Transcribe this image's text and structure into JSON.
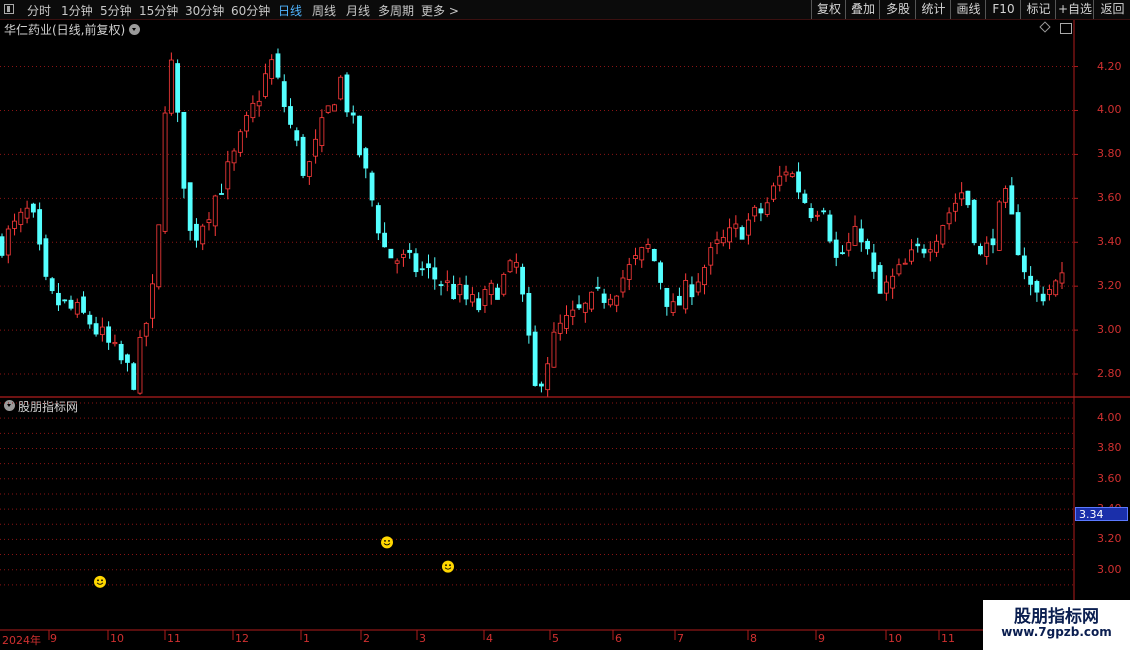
{
  "toolbar": {
    "periods": [
      "分时",
      "1分钟",
      "5分钟",
      "15分钟",
      "30分钟",
      "60分钟",
      "日线",
      "周线",
      "月线",
      "多周期",
      "更多 >"
    ],
    "active_period": "日线",
    "right_buttons": [
      "复权",
      "叠加",
      "多股",
      "统计",
      "画线",
      "F10",
      "标记",
      "+自选",
      "返回"
    ]
  },
  "main_panel": {
    "stock_title": "华仁药业(日线,前复权)",
    "price_ticks": [
      "4.20",
      "4.00",
      "3.80",
      "3.60",
      "3.40",
      "3.20",
      "3.00",
      "2.80"
    ]
  },
  "indicator_panel": {
    "title": "股朋指标网",
    "price_ticks": [
      "4.00",
      "3.80",
      "3.60",
      "3.40",
      "3.20",
      "3.00"
    ],
    "current_value": "3.34"
  },
  "time_axis": {
    "labels": [
      "2024年",
      "9",
      "10",
      "11",
      "12",
      "1",
      "2",
      "3",
      "4",
      "5",
      "6",
      "7",
      "8",
      "9",
      "10",
      "11"
    ]
  },
  "watermark": {
    "title": "股朋指标网",
    "url": "www.7gpzb.com"
  },
  "colors": {
    "up": "#ff3b3b",
    "down": "#54ffff",
    "grid": "#8a1414",
    "axis": "#b01c1c",
    "active": "#4fb4ff",
    "marker": "#ffd700"
  },
  "chart_data": {
    "type": "candlestick",
    "title": "华仁药业(日线,前复权)",
    "y_range": [
      2.7,
      4.33
    ],
    "y_ticks": [
      2.8,
      3.0,
      3.2,
      3.4,
      3.6,
      3.8,
      4.0,
      4.2
    ],
    "path": [
      [
        2024.55,
        3.4
      ],
      [
        2024.6,
        3.55
      ],
      [
        2024.63,
        3.15
      ],
      [
        2024.7,
        3.05
      ],
      [
        2024.78,
        2.78
      ],
      [
        2024.82,
        3.25
      ],
      [
        2024.84,
        4.33
      ],
      [
        2024.88,
        3.4
      ],
      [
        2024.95,
        3.75
      ],
      [
        2025.02,
        4.22
      ],
      [
        2025.08,
        3.7
      ],
      [
        2025.14,
        4.15
      ],
      [
        2025.22,
        3.35
      ],
      [
        2025.3,
        3.25
      ],
      [
        2025.38,
        3.1
      ],
      [
        2025.45,
        3.3
      ],
      [
        2025.48,
        2.72
      ],
      [
        2025.52,
        3.0
      ],
      [
        2025.62,
        3.2
      ],
      [
        2025.68,
        3.38
      ],
      [
        2025.72,
        3.08
      ],
      [
        2025.8,
        3.38
      ],
      [
        2025.88,
        3.55
      ],
      [
        2025.92,
        3.75
      ],
      [
        2025.96,
        3.55
      ],
      [
        2025.99,
        3.6
      ],
      [
        2026.0,
        3.3
      ],
      [
        2026.05,
        3.45
      ],
      [
        2026.08,
        3.15
      ],
      [
        2026.13,
        3.3
      ],
      [
        2026.18,
        3.45
      ],
      [
        2026.23,
        3.65
      ],
      [
        2026.26,
        3.3
      ],
      [
        2026.3,
        3.6
      ],
      [
        2026.35,
        3.15
      ],
      [
        2026.4,
        3.22
      ]
    ],
    "indicator_markers": [
      {
        "label": "2024年10月",
        "value": 2.92
      },
      {
        "label": "2025年2月",
        "value": 3.18
      },
      {
        "label": "2025年3月",
        "value": 3.02
      }
    ],
    "indicator_y_range": [
      2.8,
      4.12
    ]
  }
}
